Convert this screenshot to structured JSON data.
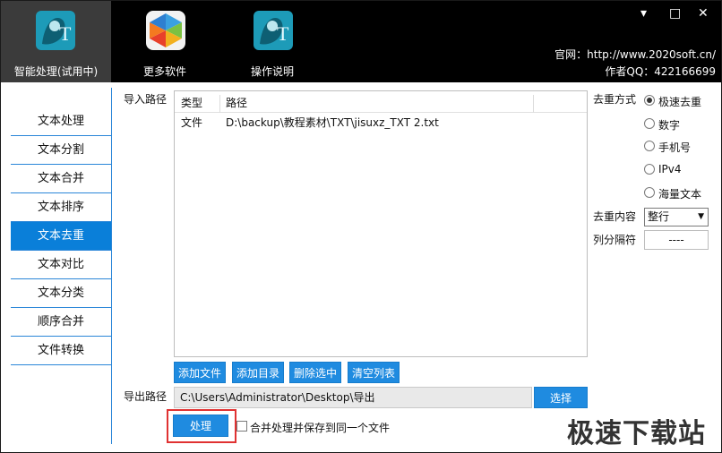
{
  "toolbar": {
    "items": [
      {
        "label": "智能处理(试用中)",
        "icon": "ai-process-icon"
      },
      {
        "label": "更多软件",
        "icon": "more-software-icon"
      },
      {
        "label": "操作说明",
        "icon": "help-icon"
      }
    ],
    "site_text": "官网：http://www.2020soft.cn/",
    "qq_text": "作者QQ：422166699",
    "win_min": "▾",
    "win_max": "□",
    "win_close": "✕"
  },
  "sidebar": {
    "items": [
      {
        "label": "文本处理"
      },
      {
        "label": "文本分割"
      },
      {
        "label": "文本合并"
      },
      {
        "label": "文本排序"
      },
      {
        "label": "文本去重"
      },
      {
        "label": "文本对比"
      },
      {
        "label": "文本分类"
      },
      {
        "label": "顺序合并"
      },
      {
        "label": "文件转换"
      }
    ],
    "active_index": 4
  },
  "import": {
    "label": "导入路径",
    "columns": [
      "类型",
      "路径"
    ],
    "rows": [
      {
        "type": "文件",
        "path": "D:\\backup\\教程素材\\TXT\\jisuxz_TXT 2.txt"
      }
    ],
    "buttons": {
      "add_file": "添加文件",
      "add_dir": "添加目录",
      "delete_selected": "删除选中",
      "clear_list": "清空列表"
    }
  },
  "export": {
    "label": "导出路径",
    "value": "C:\\Users\\Administrator\\Desktop\\导出",
    "choose_label": "选择"
  },
  "actions": {
    "process_label": "处理",
    "merge_label": "合并处理并保存到同一个文件"
  },
  "options": {
    "method_label": "去重方式",
    "methods": [
      {
        "label": "极速去重",
        "selected": true
      },
      {
        "label": "数字",
        "selected": false
      },
      {
        "label": "手机号",
        "selected": false
      },
      {
        "label": "IPv4",
        "selected": false
      },
      {
        "label": "海量文本",
        "selected": false
      }
    ],
    "content_label": "去重内容",
    "content_value": "整行",
    "separator_label": "列分隔符",
    "separator_value": "----"
  },
  "watermark": "极速下载站",
  "colors": {
    "accent": "#1f8be0",
    "sidebar_active": "#0a7fd9",
    "highlight_border": "#e03232",
    "topbar": "#000000"
  }
}
